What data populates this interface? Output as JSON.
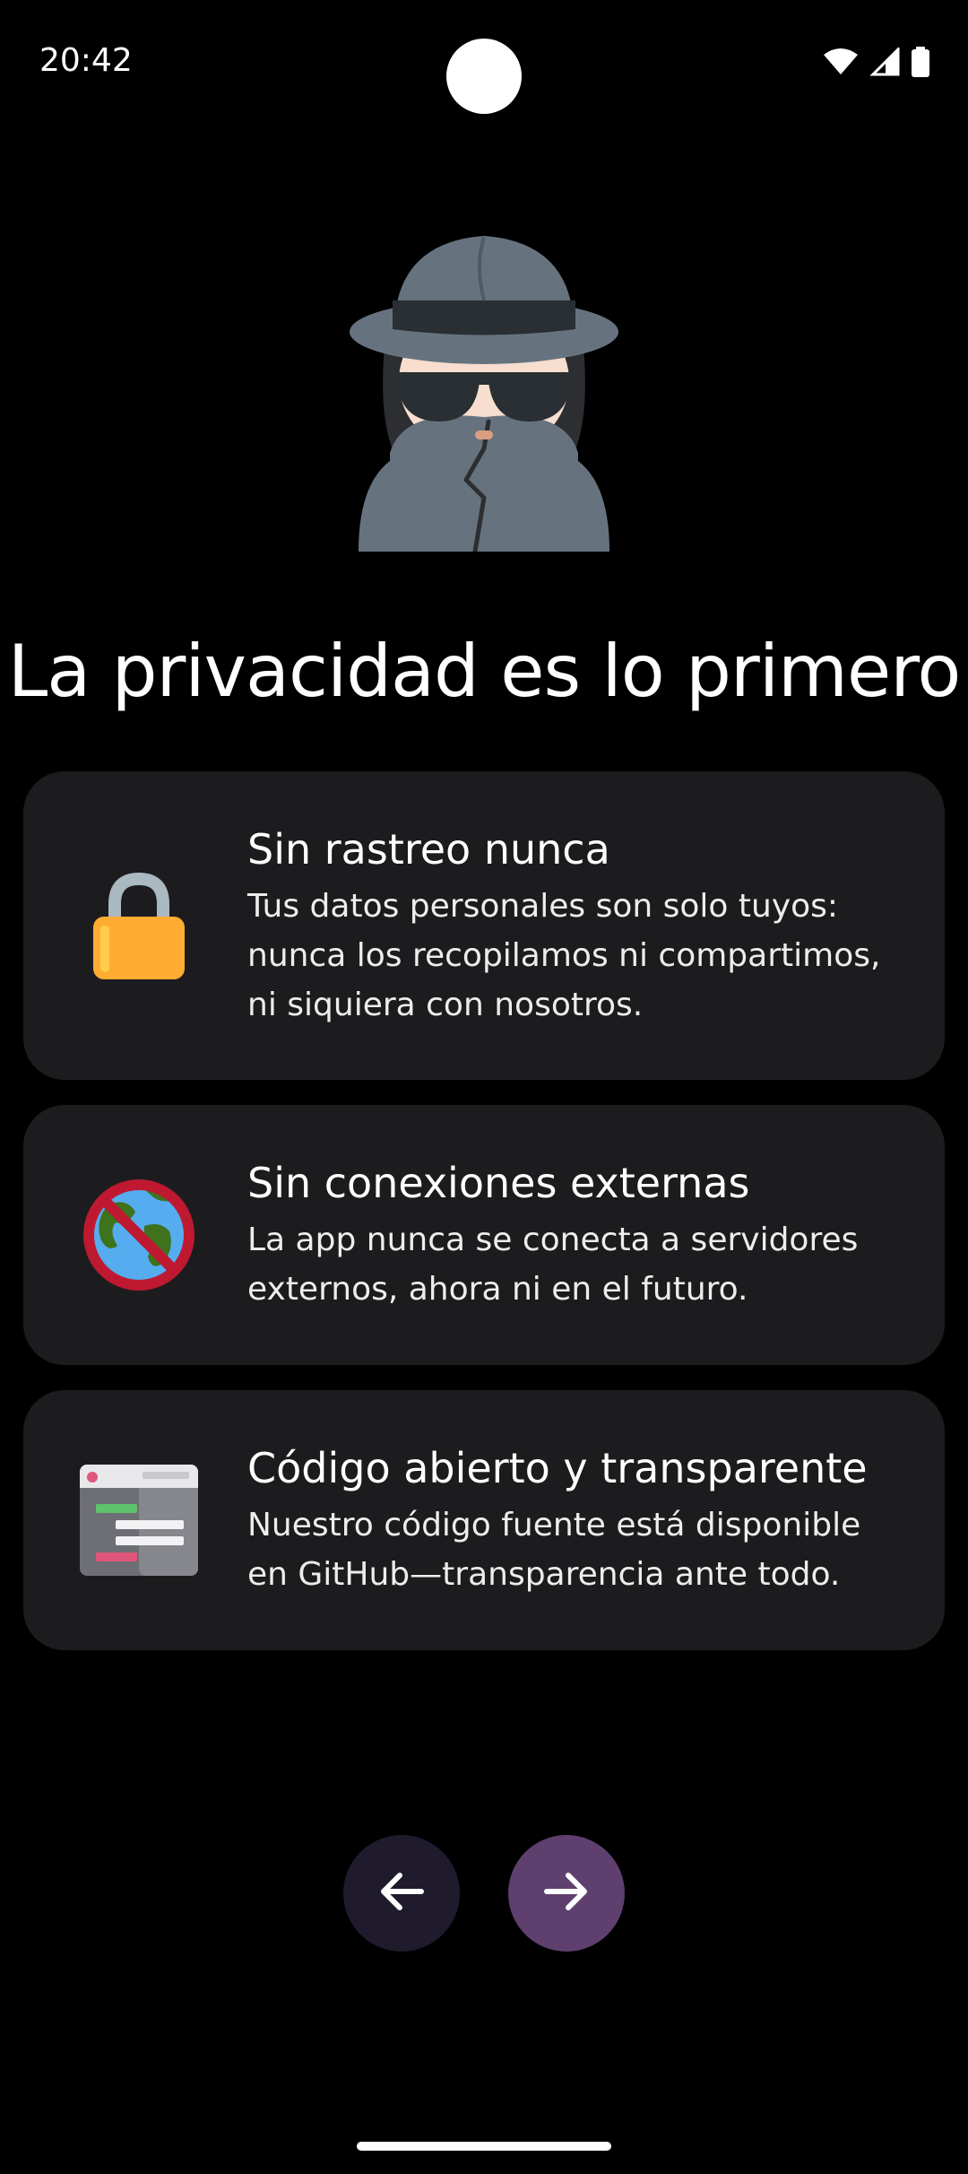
{
  "status_bar": {
    "time": "20:42",
    "icons": [
      "wifi-icon",
      "cellular-signal-icon",
      "battery-icon"
    ]
  },
  "hero": {
    "icon": "detective-icon"
  },
  "page": {
    "title": "La privacidad es lo primero"
  },
  "features": [
    {
      "icon": "lock-icon",
      "title": "Sin rastreo nunca",
      "description": "Tus datos personales son solo tuyos: nunca los recopilamos ni compartimos, ni siquiera con nosotros."
    },
    {
      "icon": "no-globe-icon",
      "title": "Sin conexiones externas",
      "description": "La app nunca se conecta a servidores externos, ahora ni en el futuro."
    },
    {
      "icon": "source-code-icon",
      "title": "Código abierto y transparente",
      "description": "Nuestro código fuente está disponible en GitHub—transparencia ante todo."
    }
  ],
  "navigation": {
    "back_icon": "arrow-left-icon",
    "next_icon": "arrow-right-icon"
  },
  "colors": {
    "background": "#000000",
    "card": "#1c1c1e",
    "back_button": "#1f1a2c",
    "next_button": "#5e3f6e"
  }
}
